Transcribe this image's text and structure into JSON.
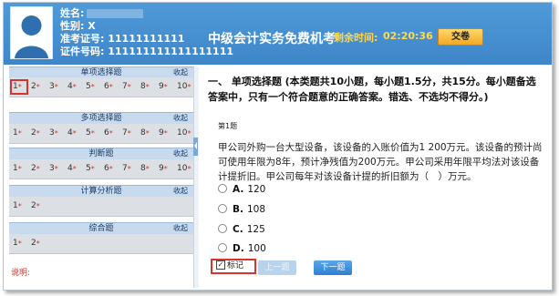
{
  "header": {
    "name_label": "姓名:",
    "gender_label": "性别: X",
    "admission_label": "准考证号: 11111111111",
    "id_label": "证件号码: 111111111111111111",
    "exam_title": "中级会计实务免费机考",
    "timer_label": "剩余时间:",
    "timer_value": "02:20:36",
    "submit_label": "交卷"
  },
  "sections": [
    {
      "title": "单项选择题",
      "collapse": "收起",
      "items": [
        "1",
        "2",
        "3",
        "4",
        "5",
        "6",
        "7",
        "8",
        "9",
        "10"
      ],
      "starred": true,
      "current": 0
    },
    {
      "title": "多项选择题",
      "collapse": "收起",
      "items": [
        "1",
        "2",
        "3",
        "4",
        "5",
        "6",
        "7",
        "8",
        "9",
        "10"
      ],
      "starred": true,
      "current": -1
    },
    {
      "title": "判断题",
      "collapse": "收起",
      "items": [
        "1",
        "2",
        "3",
        "4",
        "5",
        "6",
        "7",
        "8",
        "9",
        "10"
      ],
      "starred": true,
      "current": -1
    },
    {
      "title": "计算分析题",
      "collapse": "收起",
      "items": [
        "1",
        "2"
      ],
      "starred": true,
      "current": -1
    },
    {
      "title": "综合题",
      "collapse": "收起",
      "items": [
        "1",
        "2"
      ],
      "starred": true,
      "current": -1
    }
  ],
  "star": "*",
  "note_label": "说明:",
  "question": {
    "type_title": "一、 单项选择题 (本类题共10小题，每小题1.5分，共15分。每小题备选答案中，只有一个符合题意的正确答案。错选、不选均不得分。)",
    "number": "第1题",
    "stem": "甲公司外购一台大型设备，该设备的入账价值为1 200万元。该设备的预计尚可使用年限为8年，预计净残值为200万元。甲公司采用年限平均法对该设备计提折旧。甲公司每年对该设备计提的折旧额为（　）万元。",
    "options": [
      {
        "key": "A.",
        "value": "120"
      },
      {
        "key": "B.",
        "value": "108"
      },
      {
        "key": "C.",
        "value": "125"
      },
      {
        "key": "D.",
        "value": "100"
      }
    ]
  },
  "controls": {
    "mark_label": "标记",
    "mark_checked": "✓",
    "prev_label": "上一题",
    "next_label": "下一题"
  }
}
